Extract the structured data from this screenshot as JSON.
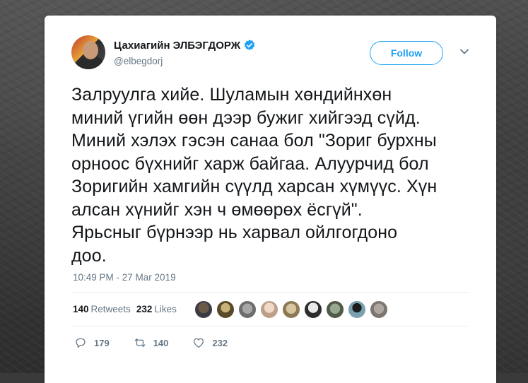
{
  "tweet": {
    "author_name": "Цахиагийн ЭЛБЭГДОРЖ",
    "author_handle": "@elbegdorj",
    "follow_label": "Follow",
    "text_lines": [
      "Залруулга хийе. Шуламын хөндийнхөн",
      "миний үгийн өөн дээр бужиг хийгээд сүйд.",
      "Миний хэлэх гэсэн санаа бол \"Зориг бурхны",
      "орноос бүхнийг харж байгаа. Алуурчид бол",
      "Зоригийн хамгийн сүүлд харсан хүмүүс. Хүн",
      "алсан хүнийг хэн ч өмөөрөх ёсгүй\".",
      "Ярьсныг бүрнээр нь харвал ойлгогдоно",
      "доо."
    ],
    "timestamp": "10:49 PM - 27 Mar 2019",
    "retweets_count": "140",
    "retweets_label": "Retweets",
    "likes_count": "232",
    "likes_label": "Likes",
    "actions": {
      "reply_count": "179",
      "retweet_count": "140",
      "like_count": "232"
    }
  },
  "colors": {
    "accent": "#1da1f2",
    "text": "#14171a",
    "muted": "#657786",
    "divider": "#e6ecf0"
  },
  "icons": [
    "verified-badge-icon",
    "chevron-down-icon",
    "reply-icon",
    "retweet-icon",
    "heart-icon"
  ]
}
